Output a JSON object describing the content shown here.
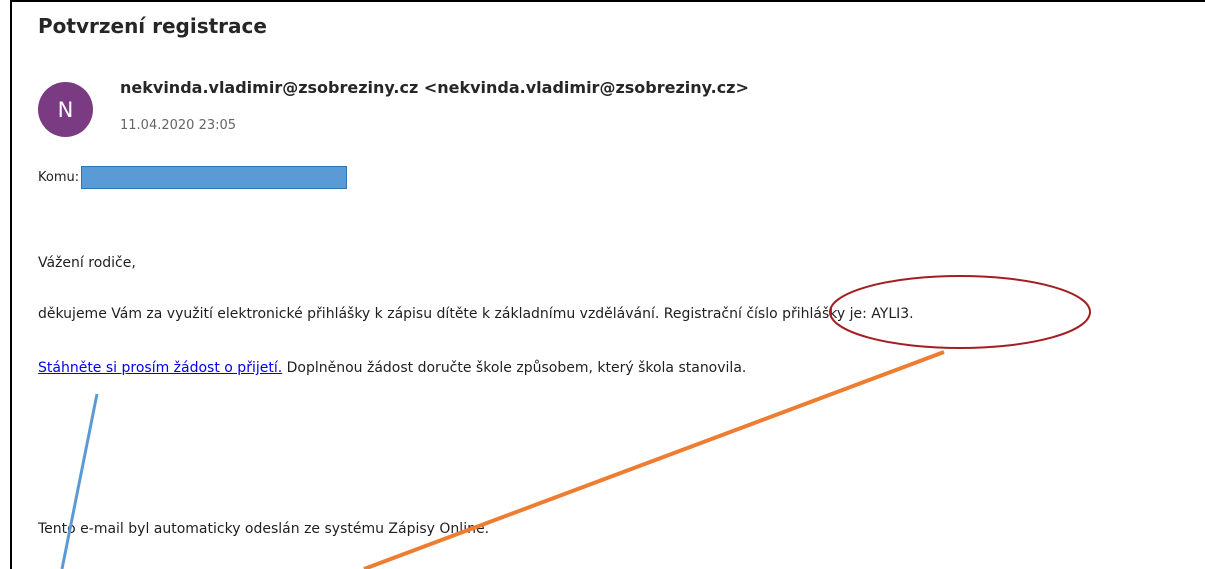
{
  "email": {
    "subject": "Potvrzení registrace",
    "avatar_letter": "N",
    "sender": "nekvinda.vladimir@zsobreziny.cz <nekvinda.vladimir@zsobreziny.cz>",
    "date": "11.04.2020 23:05",
    "to_label": "Komu:",
    "greeting": "Vážení rodiče,",
    "line2_part1": "děkujeme Vám za využití elektronické přihlášky k zápisu dítěte k základnímu vzdělávání. ",
    "line2_part2": "Registrační číslo přihlášky je: AYLI3.",
    "link_text": "Stáhněte si prosím žádost o přijetí.",
    "line3_rest": " Doplněnou žádost doručte škole způsobem, který škola stanovila.",
    "footer": "Tento e-mail byl automaticky odeslán ze systému Zápisy Online."
  },
  "colors": {
    "avatar": "#7a3b82",
    "redaction": "#5b9bd5",
    "link": "#0000ee",
    "ellipse": "#a31e22",
    "orange_line": "#ed7d31",
    "blue_line": "#5b9bd5"
  }
}
